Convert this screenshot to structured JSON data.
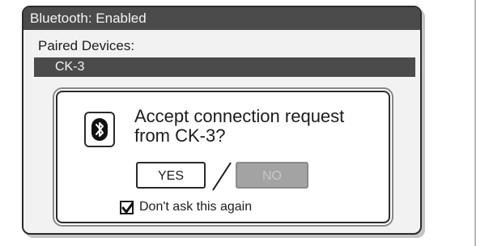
{
  "window": {
    "title": "Bluetooth: Enabled"
  },
  "paired": {
    "label": "Paired Devices:",
    "devices": [
      "CK-3"
    ]
  },
  "dialog": {
    "icon": "bluetooth-icon",
    "message_line1": "Accept connection request",
    "message_line2": "from CK-3?",
    "yes_label": "YES",
    "no_label": "NO",
    "no_disabled": true,
    "checkbox_label": "Don't ask this again",
    "checkbox_checked": true
  },
  "colors": {
    "title_bar": "#4b4b4b",
    "selected_row": "#4b4b4b",
    "disabled_button": "#a3a3a3"
  }
}
